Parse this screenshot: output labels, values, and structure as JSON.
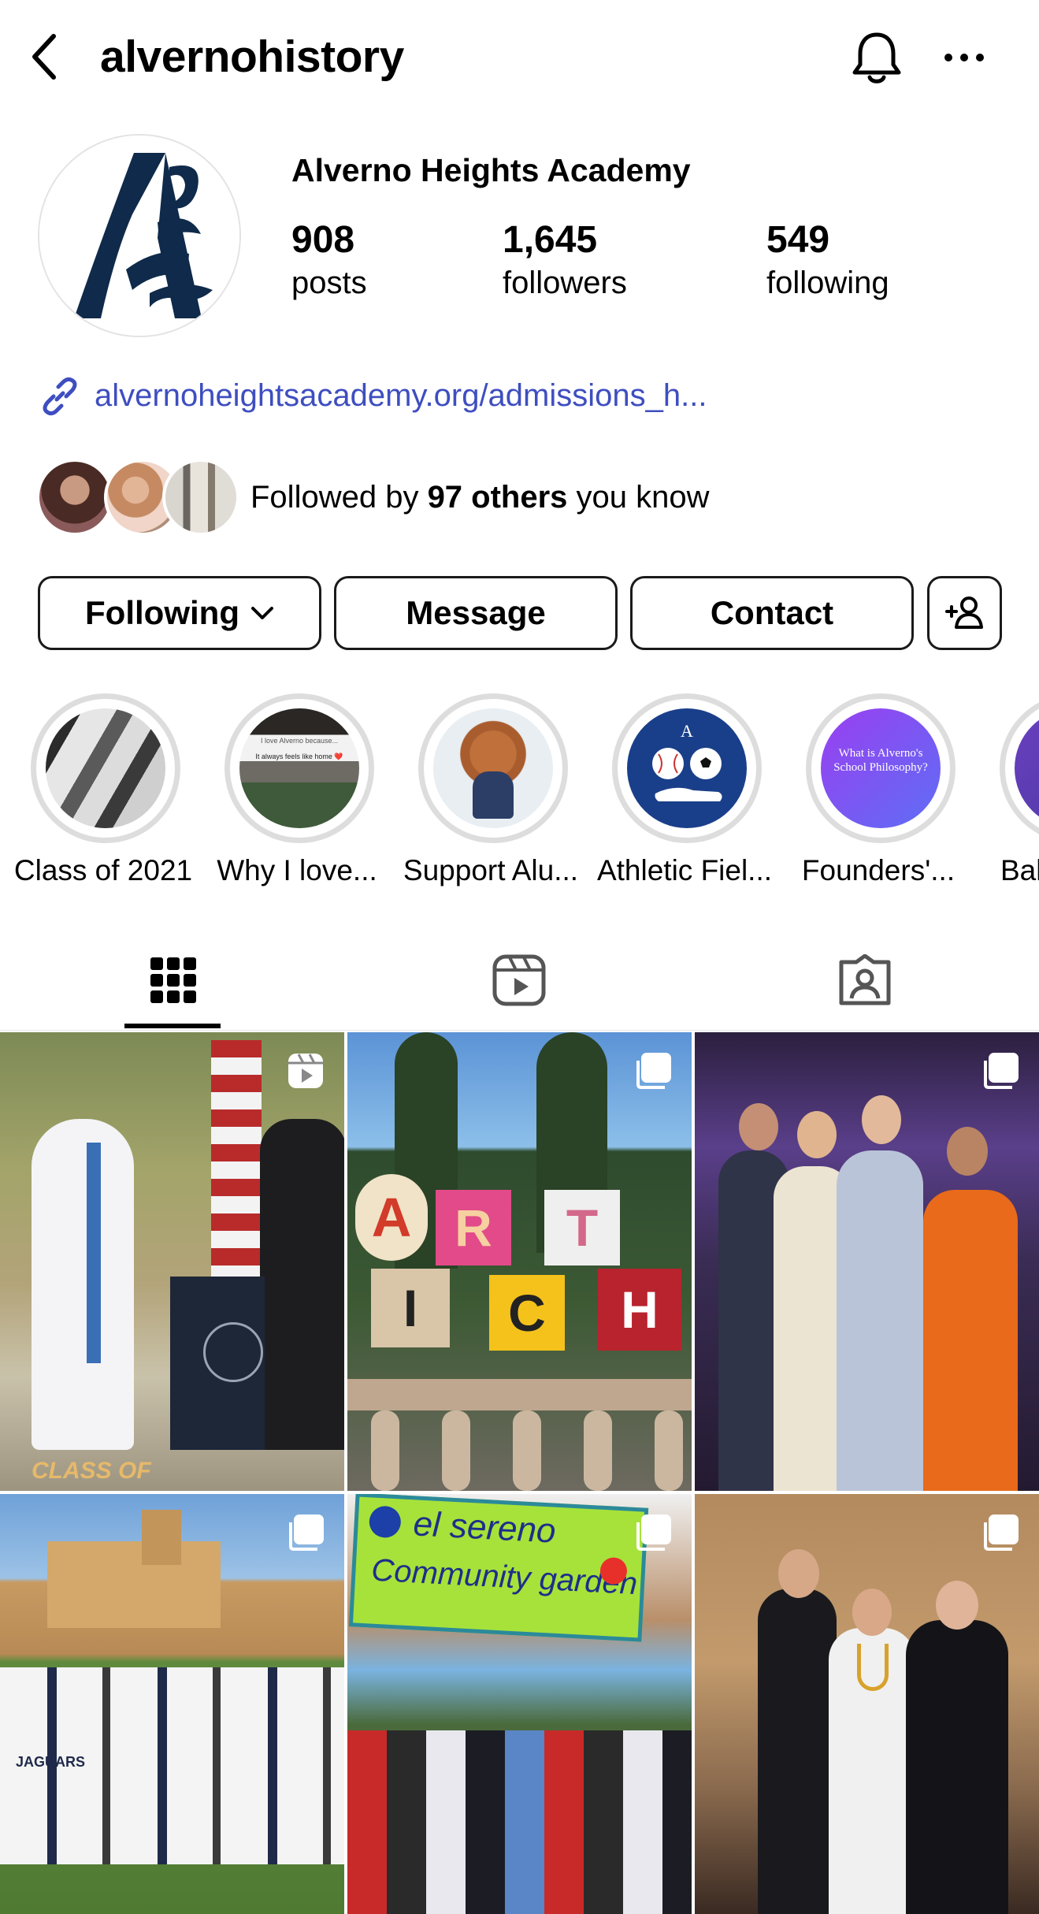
{
  "header": {
    "username": "alvernohistory",
    "icons": {
      "back": "back-chevron-icon",
      "notifications": "bell-icon",
      "more": "more-dots-icon"
    }
  },
  "profile": {
    "full_name": "Alverno Heights Academy",
    "avatar_logo_letter": "A",
    "brand_color": "#0f2a4a",
    "stats": {
      "posts": {
        "value": "908",
        "label": "posts"
      },
      "followers": {
        "value": "1,645",
        "label": "followers"
      },
      "following": {
        "value": "549",
        "label": "following"
      }
    },
    "link": "alvernoheightsacademy.org/admissions_h...",
    "link_color": "#3e4ec0",
    "followed_by": {
      "prefix": "Followed by ",
      "bold": "97 others",
      "suffix": " you know"
    }
  },
  "actions": {
    "following_label": "Following",
    "message_label": "Message",
    "contact_label": "Contact",
    "add_user_icon": "add-person-icon"
  },
  "highlights": [
    {
      "label": "Class of 2021"
    },
    {
      "label": "Why I love..."
    },
    {
      "label": "Support Alu..."
    },
    {
      "label": "Athletic Fiel..."
    },
    {
      "label": "Founders'..."
    },
    {
      "label": "Bak"
    }
  ],
  "highlight_texts": {
    "why_love_line1": "I love Alverno because...",
    "why_love_line2": "It always feels like home ❤️",
    "founders_text": "What is Alverno's School Philosophy?"
  },
  "tabs": [
    {
      "name": "grid",
      "icon": "grid-icon",
      "active": true
    },
    {
      "name": "reels",
      "icon": "reels-icon",
      "active": false
    },
    {
      "name": "tagged",
      "icon": "tagged-icon",
      "active": false
    }
  ],
  "posts": [
    {
      "type": "reel",
      "overlay_text": "CLASS OF"
    },
    {
      "type": "carousel",
      "letters": [
        "A",
        "R",
        "T",
        "I",
        "C",
        "H"
      ]
    },
    {
      "type": "carousel"
    },
    {
      "type": "carousel",
      "jersey_text": "JAGUARS"
    },
    {
      "type": "carousel",
      "sign_line1": "el sereno",
      "sign_line2": "Community garden"
    },
    {
      "type": "carousel"
    }
  ]
}
